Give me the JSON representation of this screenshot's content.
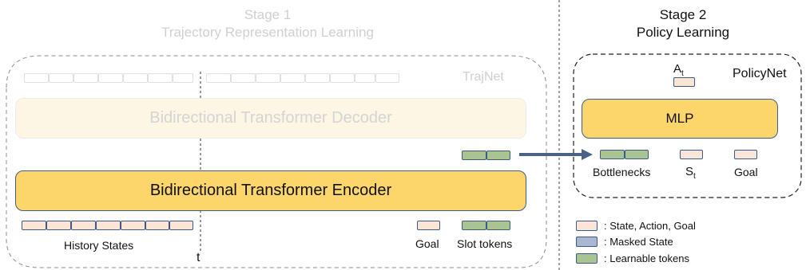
{
  "stage1": {
    "title_line1": "Stage 1",
    "title_line2": "Trajectory Representation Learning",
    "trajnet_label": "TrajNet",
    "decoder_label": "Bidirectional Transformer Decoder",
    "encoder_label": "Bidirectional Transformer Encoder",
    "history_label": "History States",
    "goal_label": "Goal",
    "slot_label": "Slot tokens",
    "time_label": "t"
  },
  "stage2": {
    "title_line1": "Stage 2",
    "title_line2": "Policy Learning",
    "policynet_label": "PolicyNet",
    "mlp_label": "MLP",
    "action_label": "A",
    "action_sub": "t",
    "bottlenecks_label": "Bottlenecks",
    "state_label": "S",
    "state_sub": "t",
    "goal_label": "Goal"
  },
  "legend": [
    {
      "text": ": State, Action, Goal",
      "kind": "state"
    },
    {
      "text": ": Masked State",
      "kind": "masked"
    },
    {
      "text": ": Learnable tokens",
      "kind": "learnable"
    }
  ],
  "colors": {
    "state_token": "#fbe5d6",
    "masked_token": "#a9b7d0",
    "learnable_token": "#a9c491",
    "block_fill": "#fcd56b",
    "block_border": "#3e5c8e",
    "arrow": "#4a6287"
  }
}
